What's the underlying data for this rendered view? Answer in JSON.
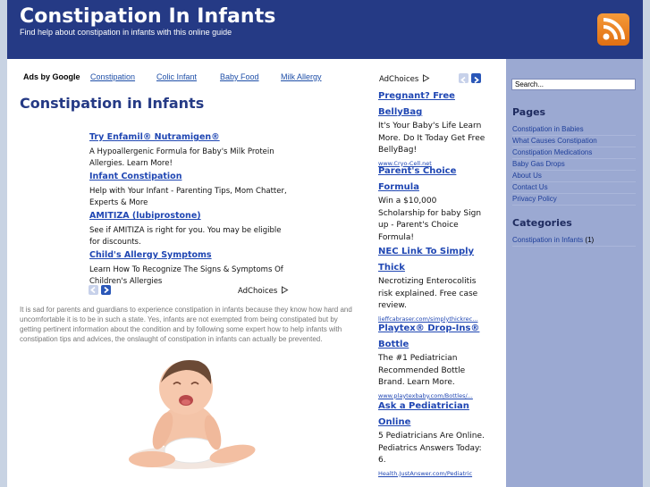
{
  "header": {
    "title": "Constipation In Infants",
    "tagline": "Find help about constipation in infants with this online guide",
    "colors": {
      "header_bg": "#253a85",
      "page_bg": "#c8d3e3",
      "sidebar_bg": "#9ba9d2",
      "link": "#2047b3"
    }
  },
  "ad_links": {
    "label": "Ads by Google",
    "links": [
      "Constipation",
      "Colic Infant",
      "Baby Food",
      "Milk Allergy"
    ]
  },
  "post": {
    "title": "Constipation in Infants",
    "intro": "It is sad for parents and guardians to experience constipation in infants because they know how hard and uncomfortable it is to be in such a state. Yes, infants are not exempted from being constipated but by getting pertinent information about the condition and by following some expert how to help infants with constipation tips and advices, the onslaught of constipation in infants can actually be prevented.",
    "image_alt": "crying-baby-photo"
  },
  "inline_ads": {
    "adchoices": "AdChoices",
    "items": [
      {
        "title": "Try Enfamil® Nutramigen®",
        "body": "A Hypoallergenic Formula for Baby's Milk Protein Allergies. Learn More!"
      },
      {
        "title": "Infant Constipation",
        "body": "Help with Your Infant - Parenting Tips, Mom Chatter, Experts & More"
      },
      {
        "title": "AMITIZA (lubiprostone)",
        "body": "See if AMITIZA is right for you. You may be eligible for discounts."
      },
      {
        "title": "Child's Allergy Symptoms",
        "body": "Learn How To Recognize The Signs & Symptoms Of Children's Allergies"
      }
    ]
  },
  "right_ads": {
    "adchoices": "AdChoices",
    "items": [
      {
        "title": "Pregnant? Free BellyBag",
        "body": "It's Your Baby's Life Learn More. Do It Today Get Free BellyBag!",
        "url": "www.Cryo-Cell.net"
      },
      {
        "title": "Parent's Choice Formula",
        "body": "Win a $10,000 Scholarship for baby Sign up - Parent's Choice Formula!",
        "url": ""
      },
      {
        "title": "NEC Link To Simply Thick",
        "body": "Necrotizing Enterocolitis risk explained. Free case review.",
        "url": "lieffcabraser.com/simplythickrec..."
      },
      {
        "title": "Playtex® Drop-Ins® Bottle",
        "body": "The #1 Pediatrician Recommended Bottle Brand. Learn More.",
        "url": "www.playtexbaby.com/Bottles/..."
      },
      {
        "title": "Ask a Pediatrician Online",
        "body": "5 Pediatricians Are Online. Pediatrics Answers Today: 6.",
        "url": "Health.JustAnswer.com/Pediatric"
      }
    ]
  },
  "sidebar": {
    "search_value": "Search...",
    "pages_heading": "Pages",
    "pages": [
      "Constipation in Babies",
      "What Causes Constipation",
      "Constipation Medications",
      "Baby Gas Drops",
      "About Us",
      "Contact Us",
      "Privacy Policy"
    ],
    "categories_heading": "Categories",
    "categories": [
      {
        "label": "Constipation in Infants",
        "count": "(1)"
      }
    ]
  }
}
